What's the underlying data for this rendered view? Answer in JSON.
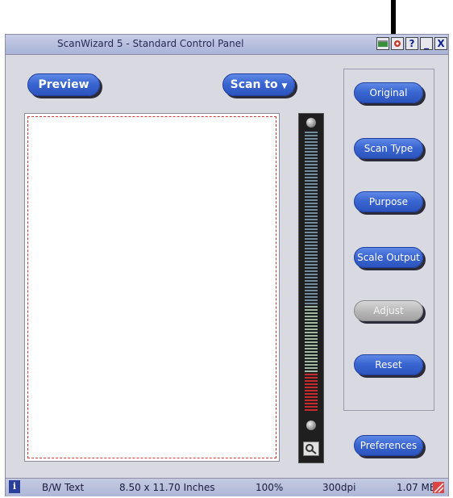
{
  "window": {
    "title": "ScanWizard 5 - Standard Control Panel",
    "controls": {
      "help": "?",
      "minimize": "_",
      "close": "X"
    }
  },
  "toolbar": {
    "preview_label": "Preview",
    "scan_to_label": "Scan to"
  },
  "side_buttons": {
    "original": "Original",
    "scan_type": "Scan Type",
    "purpose": "Purpose",
    "scale_output": "Scale Output",
    "adjust": "Adjust",
    "reset": "Reset",
    "preferences": "Preferences"
  },
  "status": {
    "info": "i",
    "scan_type": "B/W Text",
    "size": "8.50 x 11.70 Inches",
    "scale": "100%",
    "resolution": "300dpi",
    "file_size": "1.07 MB"
  },
  "colors": {
    "button_blue": "#3a66d2",
    "button_disabled": "#b7b7b7",
    "titlebar": "#a9b3d8",
    "crop_dash": "#d23a3a",
    "zoom_segment": "#6f8fa0",
    "zoom_segment_active": "#c72b2b"
  },
  "icons": {
    "annotation_arrow": "down-arrow-icon",
    "app_menu": "scanner-icon",
    "zoom": "magnifier-icon",
    "info": "info-icon",
    "resize": "resize-grip-icon"
  }
}
